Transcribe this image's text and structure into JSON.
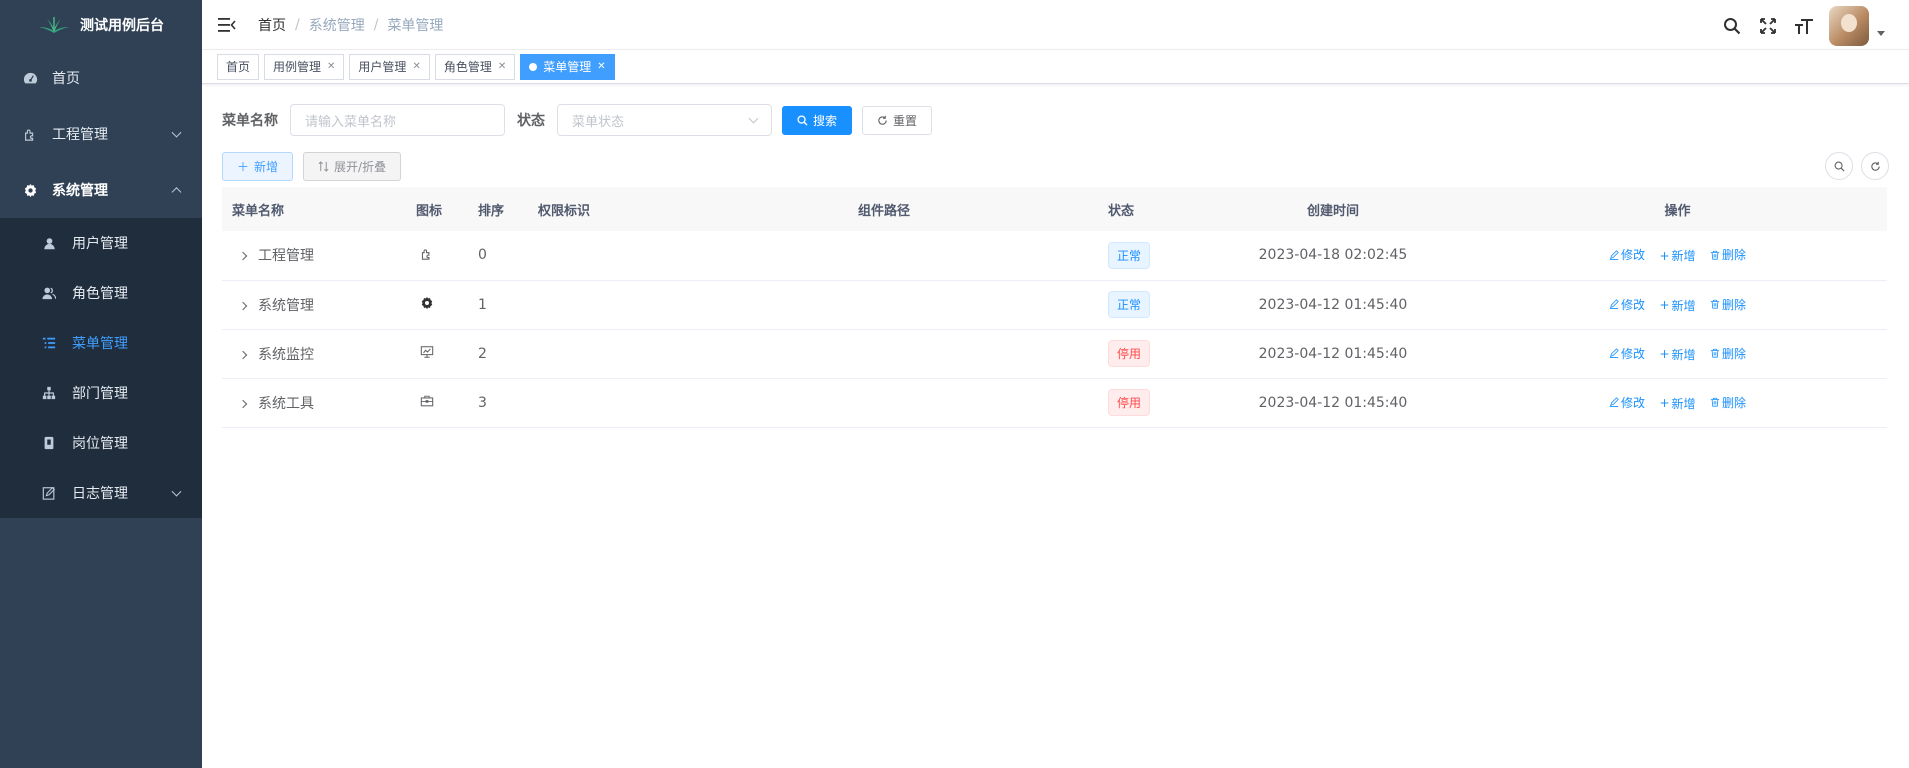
{
  "app": {
    "logo_text": "测试用例后台"
  },
  "sidebar": {
    "items": [
      {
        "label": "首页",
        "icon": "dashboard-icon"
      },
      {
        "label": "工程管理",
        "icon": "puzzle-icon",
        "expanded": false
      },
      {
        "label": "系统管理",
        "icon": "gear-icon",
        "expanded": true
      }
    ],
    "sub_items": [
      {
        "label": "用户管理",
        "icon": "user-icon"
      },
      {
        "label": "角色管理",
        "icon": "peoples-icon"
      },
      {
        "label": "菜单管理",
        "icon": "tree-table-icon",
        "active": true
      },
      {
        "label": "部门管理",
        "icon": "org-tree-icon"
      },
      {
        "label": "岗位管理",
        "icon": "post-icon"
      },
      {
        "label": "日志管理",
        "icon": "log-icon",
        "has_children": true
      }
    ]
  },
  "header": {
    "breadcrumb": [
      "首页",
      "系统管理",
      "菜单管理"
    ],
    "icons": [
      "search-icon",
      "fullscreen-icon",
      "font-size-icon"
    ]
  },
  "tags": [
    {
      "label": "首页",
      "closable": false
    },
    {
      "label": "用例管理",
      "closable": true
    },
    {
      "label": "用户管理",
      "closable": true
    },
    {
      "label": "角色管理",
      "closable": true
    },
    {
      "label": "菜单管理",
      "closable": true,
      "active": true
    }
  ],
  "search": {
    "name_label": "菜单名称",
    "name_placeholder": "请输入菜单名称",
    "status_label": "状态",
    "status_placeholder": "菜单状态",
    "search_btn": "搜索",
    "reset_btn": "重置"
  },
  "toolbar": {
    "add_btn": "新增",
    "expand_btn": "展开/折叠"
  },
  "table": {
    "columns": [
      "菜单名称",
      "图标",
      "排序",
      "权限标识",
      "组件路径",
      "状态",
      "创建时间",
      "操作"
    ],
    "rows": [
      {
        "name": "工程管理",
        "icon": "puzzle-icon",
        "sort": "0",
        "perm": "",
        "path": "",
        "status": "正常",
        "status_type": "normal",
        "time": "2023-04-18 02:02:45"
      },
      {
        "name": "系统管理",
        "icon": "gear-icon",
        "sort": "1",
        "perm": "",
        "path": "",
        "status": "正常",
        "status_type": "normal",
        "time": "2023-04-12 01:45:40"
      },
      {
        "name": "系统监控",
        "icon": "monitor-icon",
        "sort": "2",
        "perm": "",
        "path": "",
        "status": "停用",
        "status_type": "disabled",
        "time": "2023-04-12 01:45:40"
      },
      {
        "name": "系统工具",
        "icon": "toolbox-icon",
        "sort": "3",
        "perm": "",
        "path": "",
        "status": "停用",
        "status_type": "disabled",
        "time": "2023-04-12 01:45:40"
      }
    ],
    "ops": {
      "edit": "修改",
      "add": "新增",
      "delete": "删除"
    }
  },
  "colors": {
    "sidebar_bg": "#304156",
    "submenu_bg": "#1f2d3d",
    "primary": "#1890ff",
    "danger": "#ff4949"
  }
}
